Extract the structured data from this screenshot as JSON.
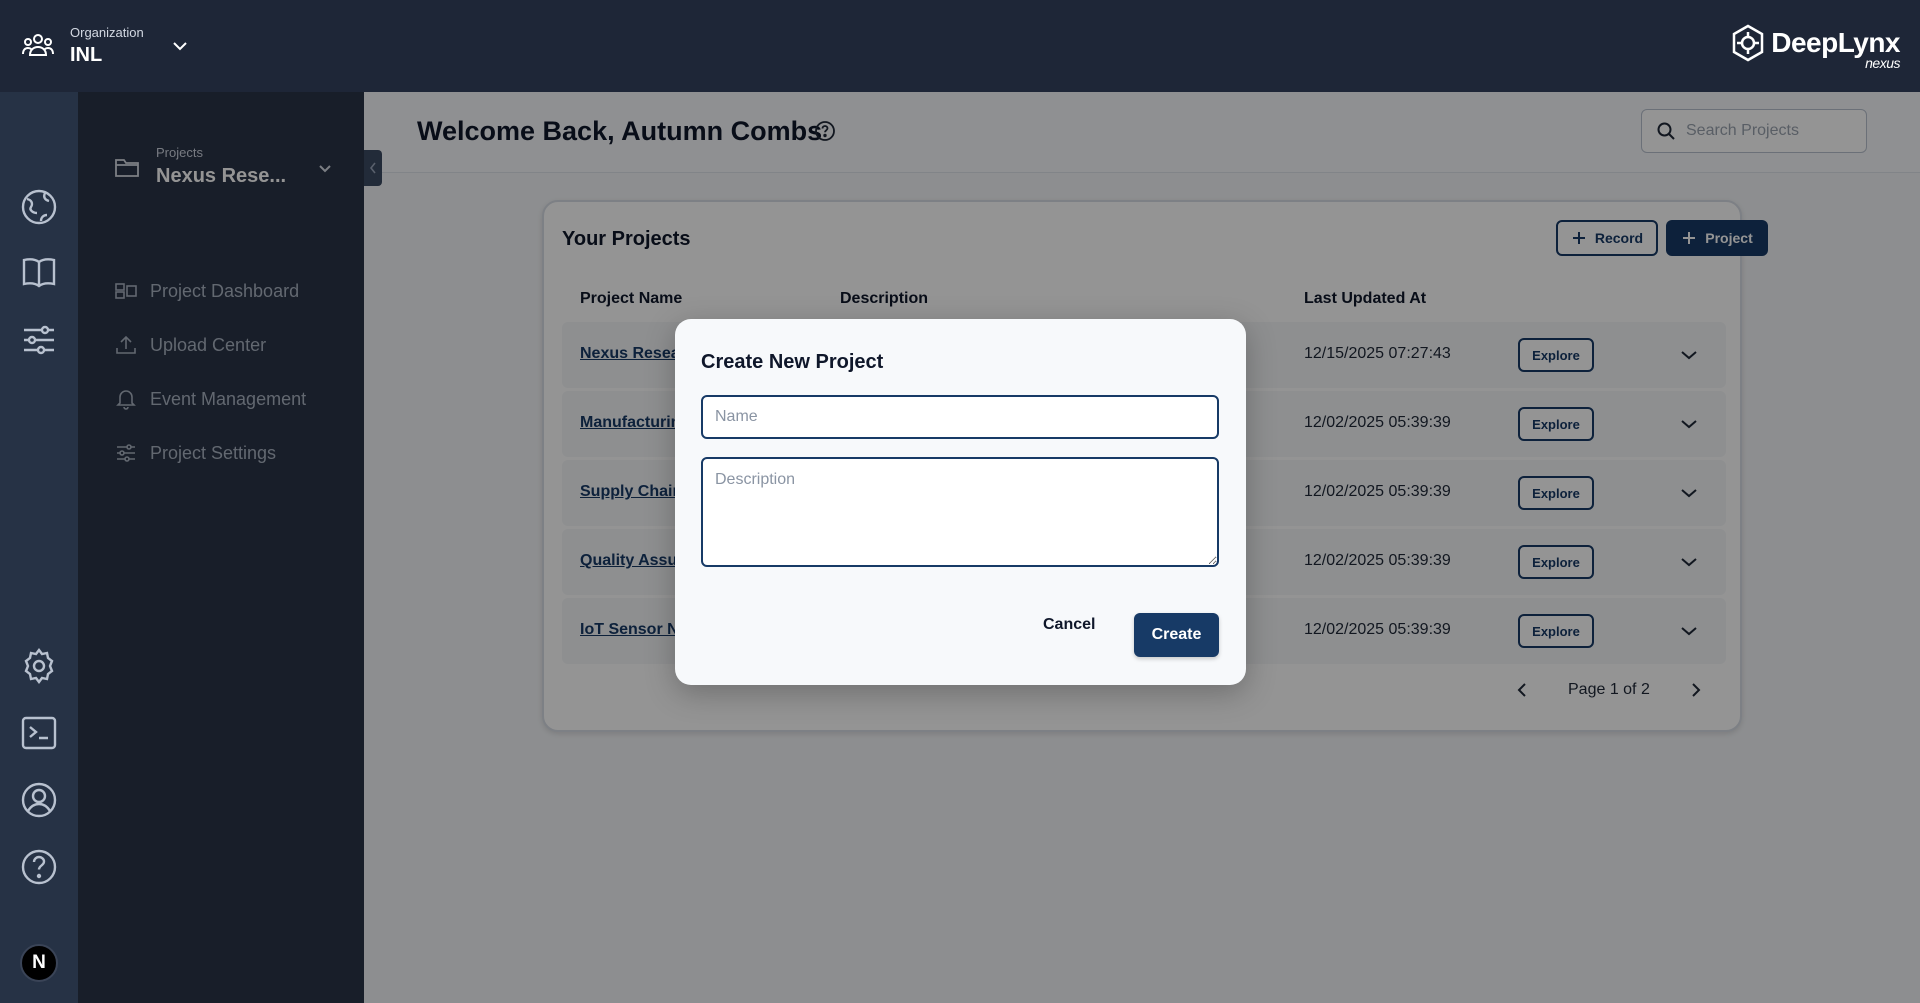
{
  "org": {
    "label": "Organization",
    "name": "INL"
  },
  "brand": {
    "name": "DeepLynx",
    "sub": "nexus"
  },
  "rail": {
    "avatar_letter": "N",
    "icons": [
      "globe-icon",
      "book-icon",
      "sliders-icon",
      "settings-icon",
      "terminal-icon",
      "user-icon",
      "help-icon"
    ]
  },
  "sidebar": {
    "projects_label": "Projects",
    "project_name": "Nexus Rese...",
    "items": [
      {
        "label": "Project Dashboard",
        "icon": "dashboard-icon"
      },
      {
        "label": "Upload Center",
        "icon": "upload-icon"
      },
      {
        "label": "Event Management",
        "icon": "bell-icon"
      },
      {
        "label": "Project Settings",
        "icon": "settings-sliders-icon"
      }
    ]
  },
  "header": {
    "welcome": "Welcome Back, Autumn Combs",
    "search_placeholder": "Search Projects"
  },
  "projects": {
    "title": "Your Projects",
    "record_button": "Record",
    "project_button": "Project",
    "columns": {
      "name": "Project Name",
      "description": "Description",
      "updated": "Last Updated At"
    },
    "rows": [
      {
        "name": "Nexus Resear",
        "updated": "12/15/2025 07:27:43",
        "explore": "Explore"
      },
      {
        "name": "Manufacturin",
        "updated": "12/02/2025 05:39:39",
        "explore": "Explore"
      },
      {
        "name": "Supply Chain",
        "updated": "12/02/2025 05:39:39",
        "explore": "Explore"
      },
      {
        "name": "Quality Assur",
        "updated": "12/02/2025 05:39:39",
        "explore": "Explore"
      },
      {
        "name": "IoT Sensor Ne",
        "updated": "12/02/2025 05:39:39",
        "explore": "Explore"
      }
    ],
    "pagination": "Page 1 of 2"
  },
  "modal": {
    "title": "Create New Project",
    "name_placeholder": "Name",
    "description_placeholder": "Description",
    "cancel": "Cancel",
    "create": "Create"
  },
  "colors": {
    "topbar": "#1e2637",
    "rail": "#263245",
    "panel": "#2a3447",
    "accent": "#173a66"
  }
}
